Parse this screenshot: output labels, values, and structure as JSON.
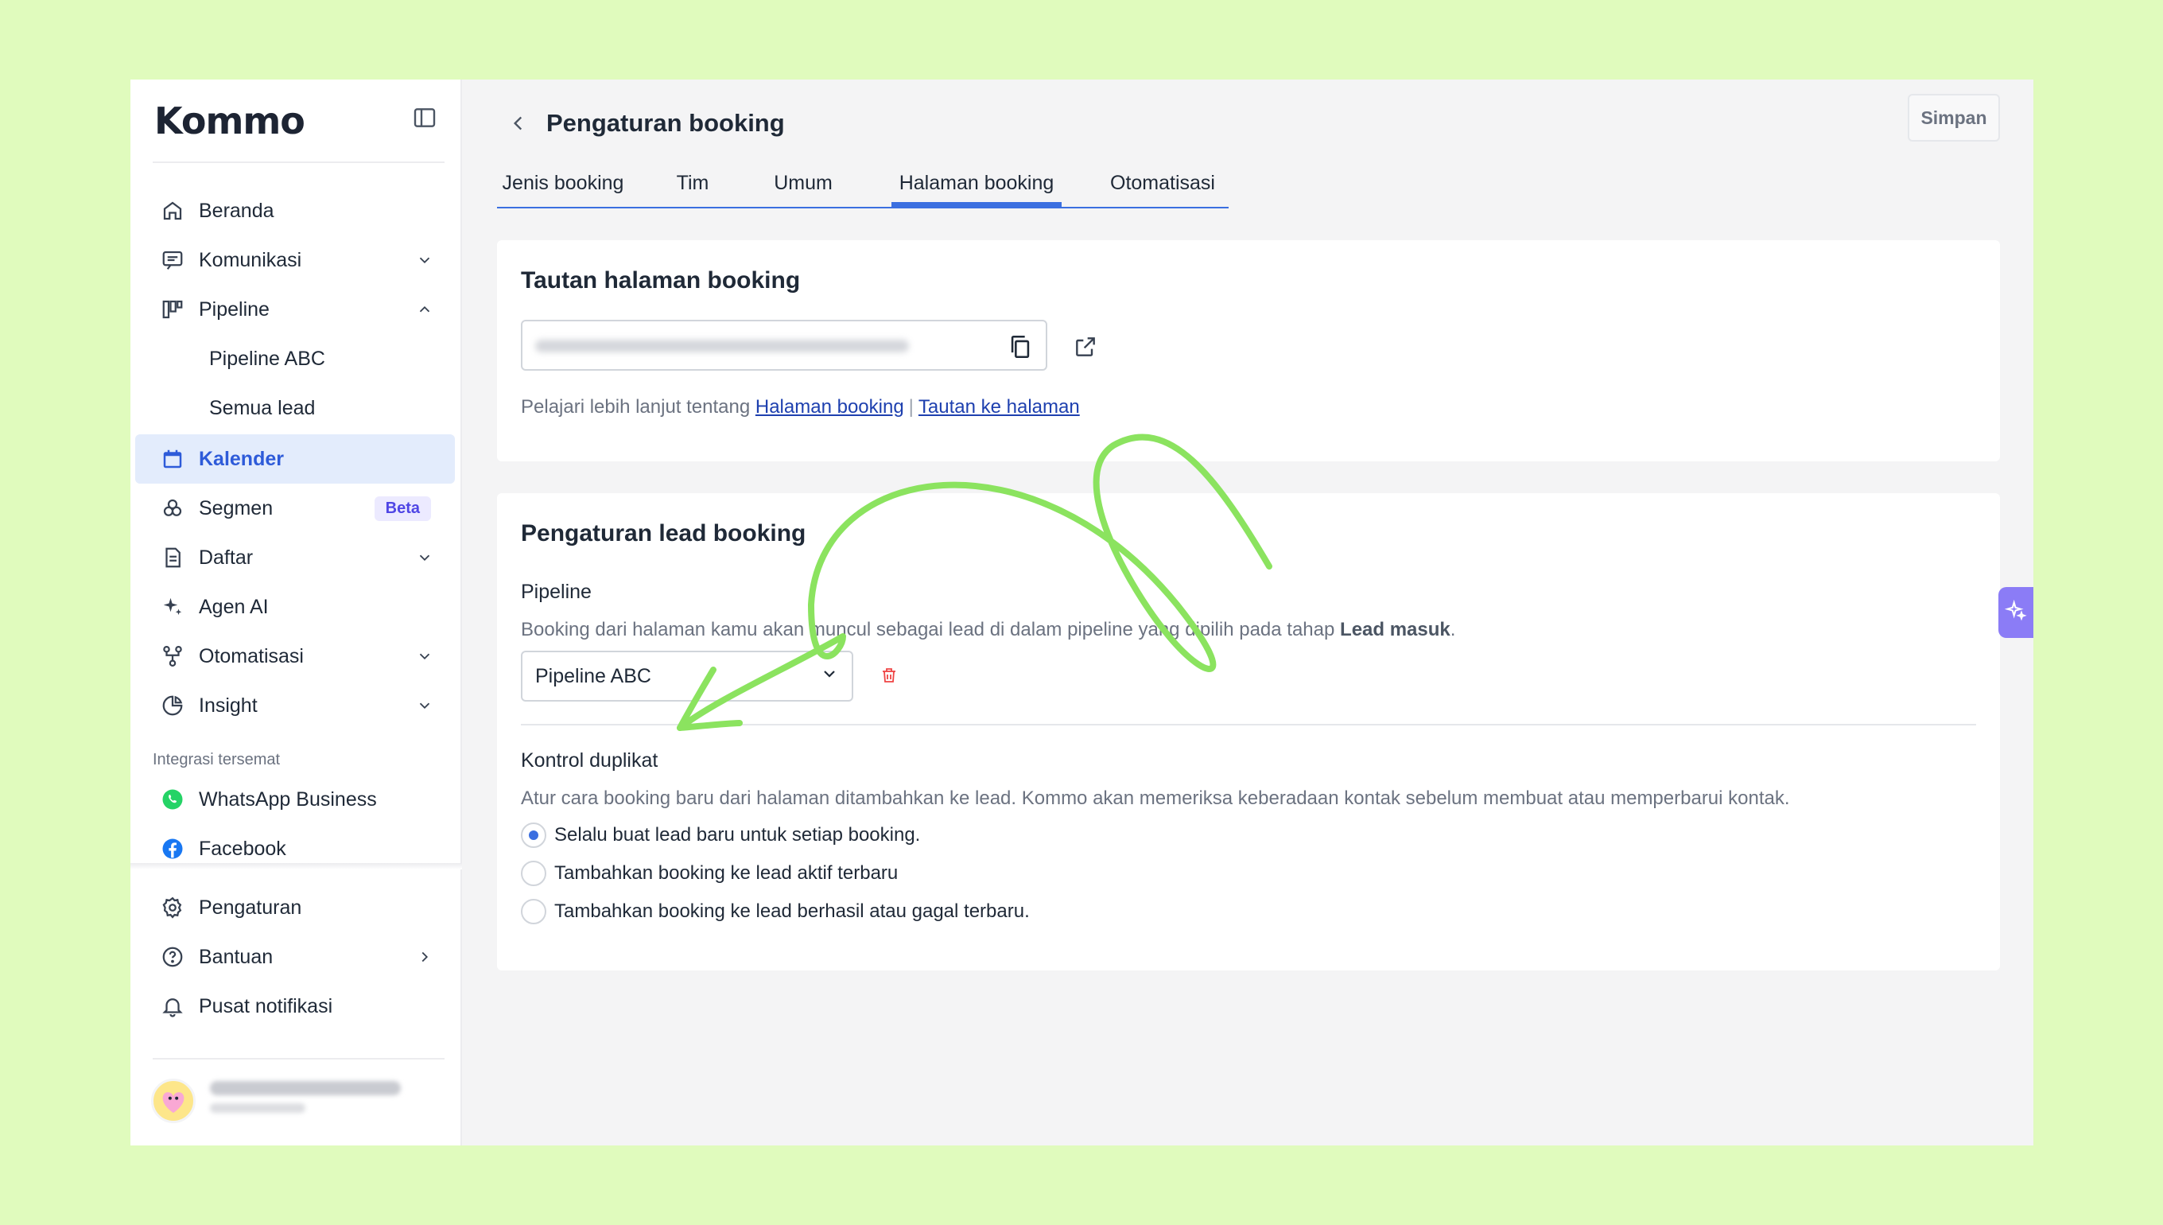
{
  "brand": {
    "logo_text": "Kommo"
  },
  "sidebar": {
    "items": [
      {
        "label": "Beranda",
        "icon": "home-icon"
      },
      {
        "label": "Komunikasi",
        "icon": "chat-icon"
      },
      {
        "label": "Pipeline",
        "icon": "pipeline-icon"
      },
      {
        "label": "Pipeline ABC"
      },
      {
        "label": "Semua lead"
      },
      {
        "label": "Kalender",
        "icon": "calendar-icon"
      },
      {
        "label": "Segmen",
        "icon": "segment-icon",
        "badge": "Beta"
      },
      {
        "label": "Daftar",
        "icon": "list-icon"
      },
      {
        "label": "Agen AI",
        "icon": "sparkle-icon"
      },
      {
        "label": "Otomatisasi",
        "icon": "automation-icon"
      },
      {
        "label": "Insight",
        "icon": "pie-chart-icon"
      }
    ],
    "integrations_label": "Integrasi tersemat",
    "integrations": [
      {
        "label": "WhatsApp Business",
        "icon": "whatsapp-icon"
      },
      {
        "label": "Facebook",
        "icon": "facebook-icon"
      }
    ],
    "bottom_items": [
      {
        "label": "Pengaturan",
        "icon": "gear-icon"
      },
      {
        "label": "Bantuan",
        "icon": "help-icon"
      },
      {
        "label": "Pusat notifikasi",
        "icon": "bell-icon"
      }
    ]
  },
  "header": {
    "title": "Pengaturan booking",
    "save_label": "Simpan"
  },
  "tabs": [
    {
      "label": "Jenis booking"
    },
    {
      "label": "Tim"
    },
    {
      "label": "Umum"
    },
    {
      "label": "Halaman booking",
      "active": true
    },
    {
      "label": "Otomatisasi"
    }
  ],
  "link_card": {
    "title": "Tautan halaman booking",
    "learn_prefix": "Pelajari lebih lanjut tentang",
    "link1": "Halaman booking",
    "separator": "|",
    "link2": "Tautan ke halaman"
  },
  "lead_card": {
    "title": "Pengaturan lead booking",
    "pipeline_label": "Pipeline",
    "pipeline_help_prefix": "Booking dari halaman kamu akan muncul sebagai lead di dalam pipeline yang dipilih pada tahap",
    "pipeline_help_bold": "Lead masuk",
    "pipeline_help_suffix": ".",
    "pipeline_value": "Pipeline ABC",
    "duplicate_label": "Kontrol duplikat",
    "duplicate_help": "Atur cara booking baru dari halaman ditambahkan ke lead. Kommo akan memeriksa keberadaan kontak sebelum membuat atau memperbarui kontak.",
    "options": [
      {
        "label": "Selalu buat lead baru untuk setiap booking.",
        "checked": true
      },
      {
        "label": "Tambahkan booking ke lead aktif terbaru",
        "checked": false
      },
      {
        "label": "Tambahkan booking ke lead berhasil atau gagal terbaru.",
        "checked": false
      }
    ]
  },
  "colors": {
    "background": "#e0fbbd",
    "accent": "#3b6fe0",
    "doodle": "#8be35f",
    "ai_button": "#8b7cf6"
  }
}
